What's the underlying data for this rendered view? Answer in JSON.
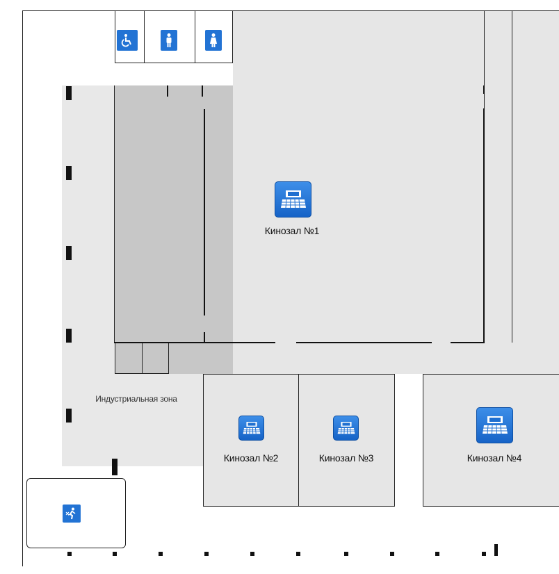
{
  "colors": {
    "corridor": "#e6e6e6",
    "industrial_zone": "#e8e8e8",
    "restroom_block": "#c7c7c7",
    "hall": "#e6e6e6",
    "wall": "#111111",
    "icon_blue": "#1f6fd0",
    "label_text": "#111111"
  },
  "halls": [
    {
      "id": "hall-1",
      "label": "Кинозал №1",
      "icon": "cinema-hall-icon"
    },
    {
      "id": "hall-2",
      "label": "Кинозал №2",
      "icon": "cinema-hall-icon"
    },
    {
      "id": "hall-3",
      "label": "Кинозал №3",
      "icon": "cinema-hall-icon"
    },
    {
      "id": "hall-4",
      "label": "Кинозал №4",
      "icon": "cinema-hall-icon"
    }
  ],
  "zones": {
    "industrial": {
      "label": "Индустриальная зона"
    }
  },
  "restroom_icons": [
    "wheelchair-accessible-icon",
    "men-restroom-icon",
    "women-restroom-icon"
  ],
  "emergency_exit": {
    "icon": "emergency-exit-icon"
  }
}
